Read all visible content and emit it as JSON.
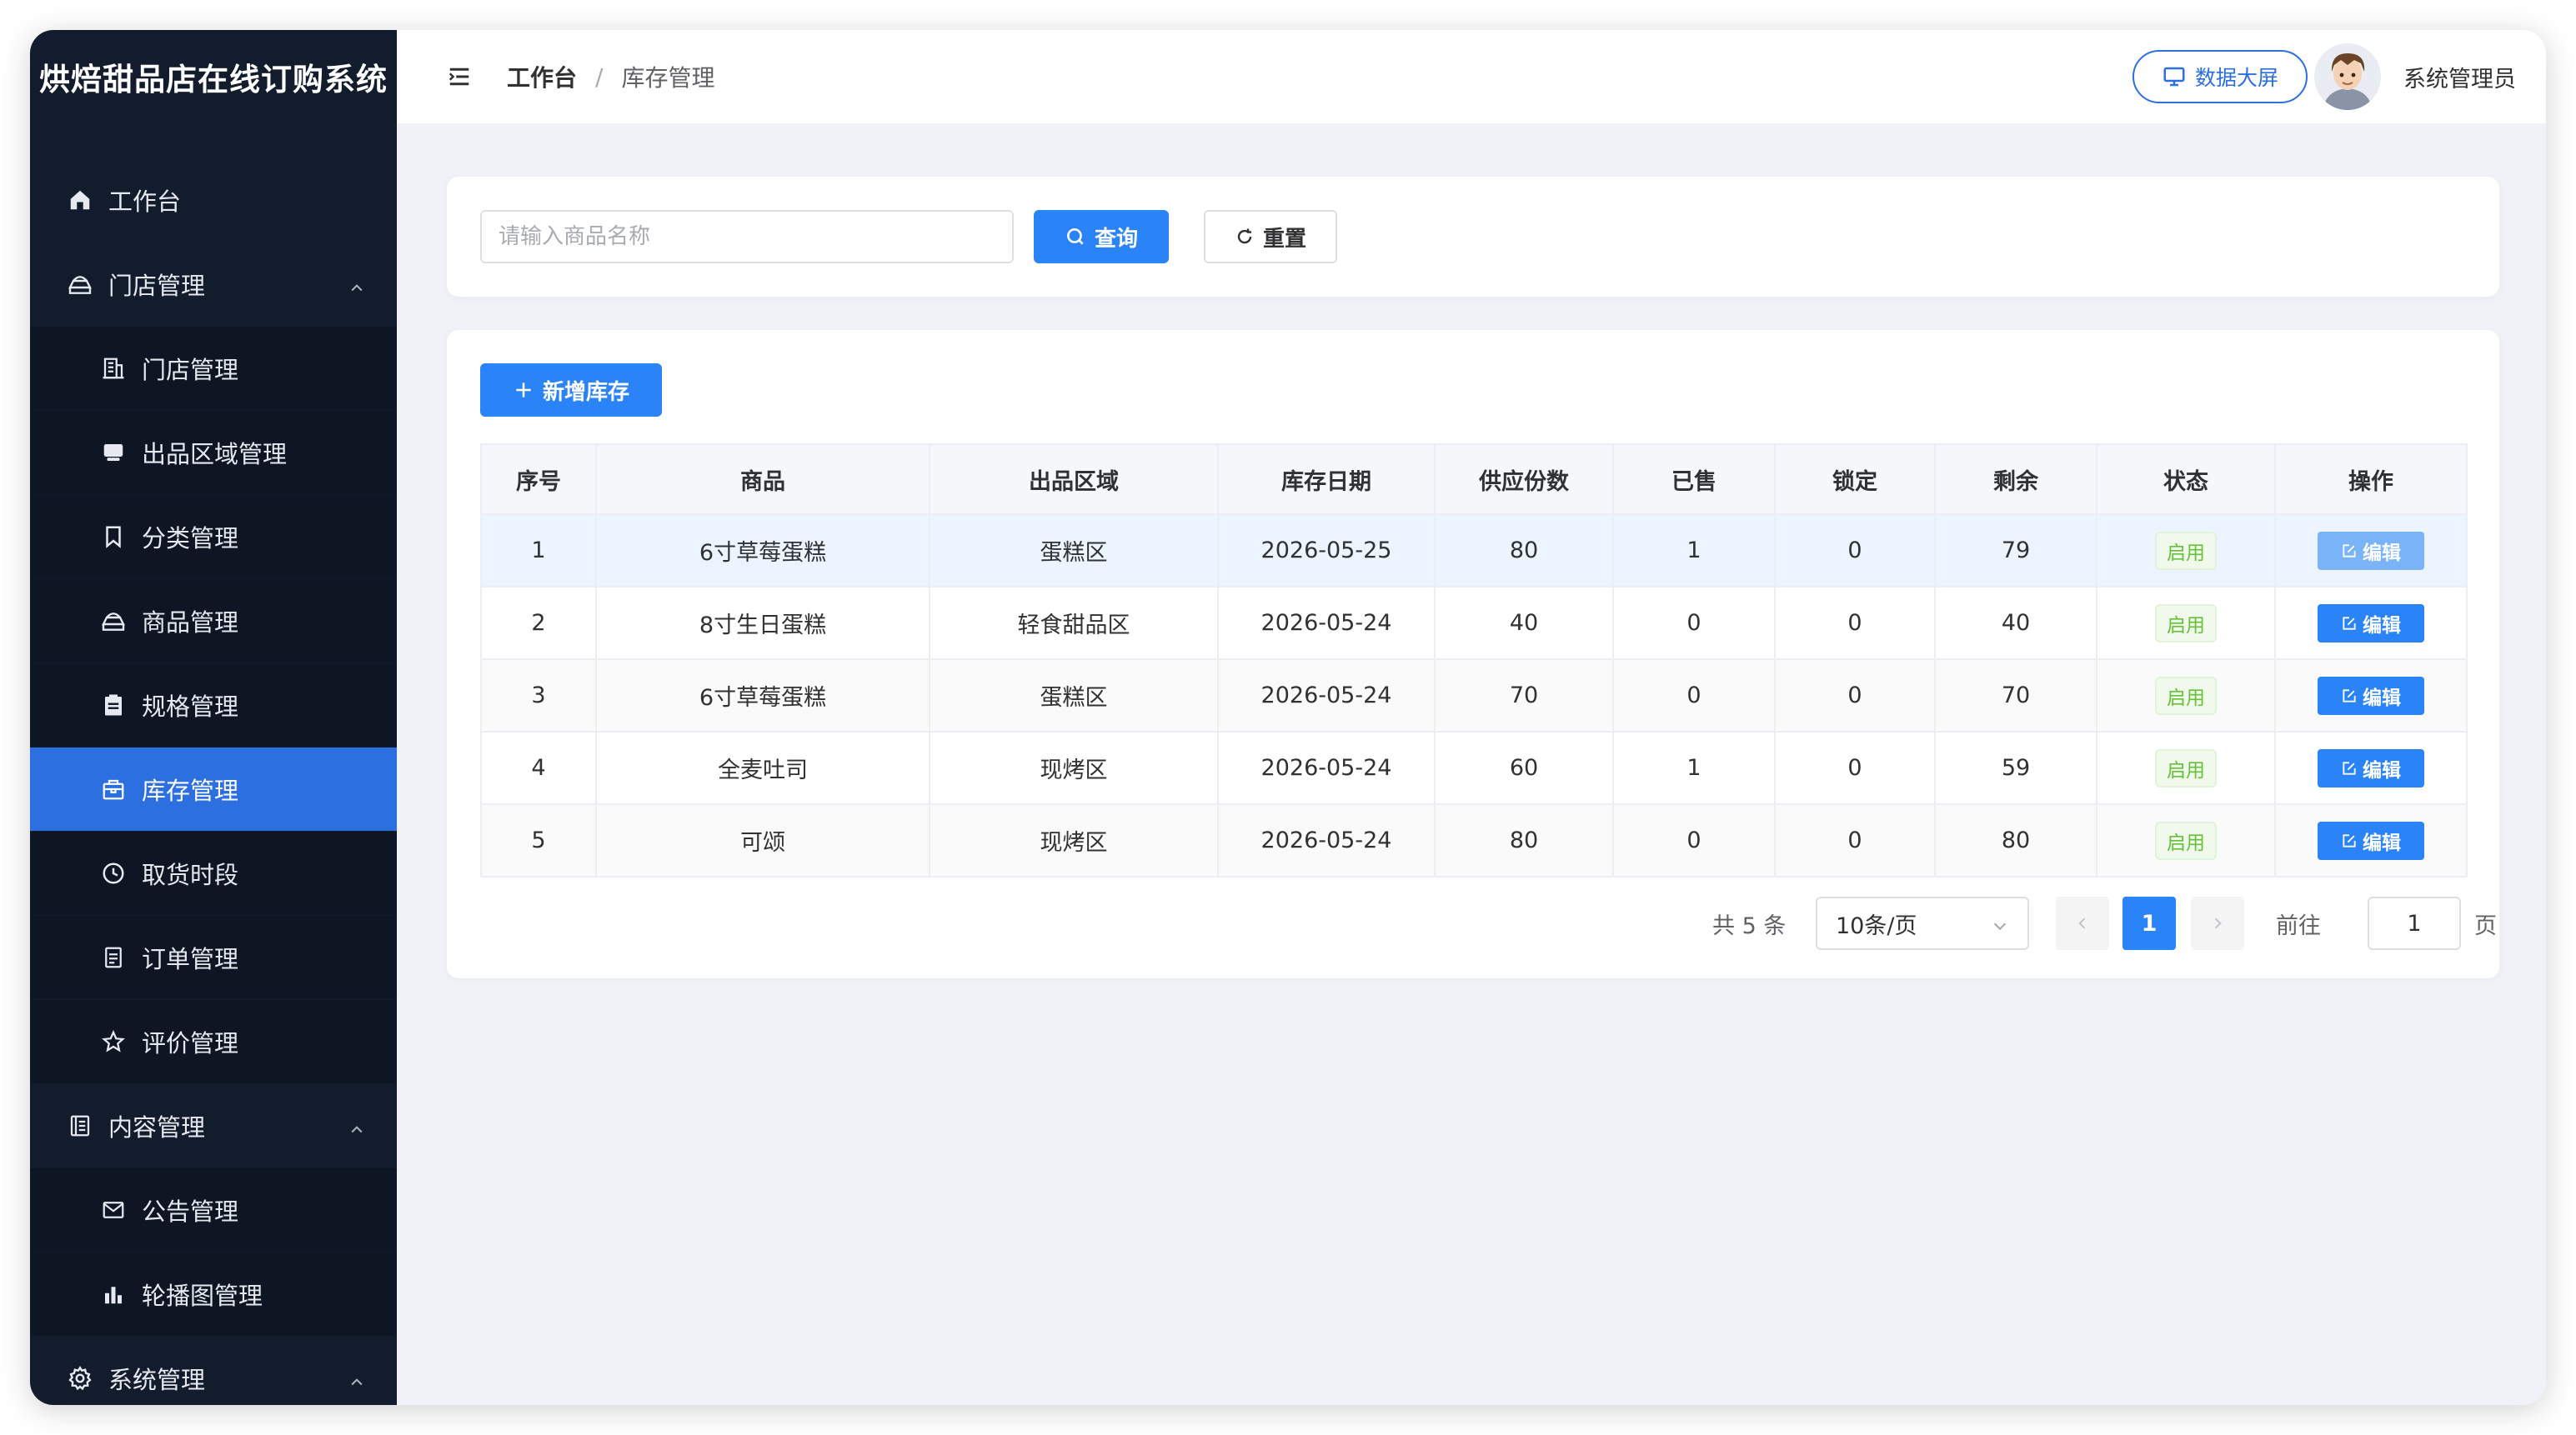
{
  "app": {
    "title": "烘焙甜品店在线订购系统"
  },
  "sidebar": {
    "items": [
      {
        "label": "工作台",
        "icon": "home-icon",
        "level": "top",
        "active": false
      },
      {
        "label": "门店管理",
        "icon": "store-icon",
        "level": "top",
        "expanded": true
      },
      {
        "label": "门店管理",
        "icon": "building-icon",
        "level": "sub",
        "active": false
      },
      {
        "label": "出品区域管理",
        "icon": "tray-icon",
        "level": "sub",
        "active": false
      },
      {
        "label": "分类管理",
        "icon": "bookmark-icon",
        "level": "sub",
        "active": false
      },
      {
        "label": "商品管理",
        "icon": "cake-icon",
        "level": "sub",
        "active": false
      },
      {
        "label": "规格管理",
        "icon": "clipboard-icon",
        "level": "sub",
        "active": false
      },
      {
        "label": "库存管理",
        "icon": "box-icon",
        "level": "sub",
        "active": true
      },
      {
        "label": "取货时段",
        "icon": "clock-icon",
        "level": "sub",
        "active": false
      },
      {
        "label": "订单管理",
        "icon": "document-icon",
        "level": "sub",
        "active": false
      },
      {
        "label": "评价管理",
        "icon": "star-icon",
        "level": "sub",
        "active": false
      },
      {
        "label": "内容管理",
        "icon": "notebook-icon",
        "level": "top",
        "expanded": true
      },
      {
        "label": "公告管理",
        "icon": "mail-icon",
        "level": "sub",
        "active": false
      },
      {
        "label": "轮播图管理",
        "icon": "bar-chart-icon",
        "level": "sub",
        "active": false
      },
      {
        "label": "系统管理",
        "icon": "gear-icon",
        "level": "top",
        "expanded": true
      }
    ]
  },
  "header": {
    "breadcrumb": [
      "工作台",
      "库存管理"
    ],
    "separator": "/",
    "screen_button": "数据大屏",
    "username": "系统管理员"
  },
  "search": {
    "placeholder": "请输入商品名称",
    "value": "",
    "query_label": "查询",
    "reset_label": "重置"
  },
  "toolbar": {
    "add_label": "新增库存"
  },
  "table": {
    "columns": [
      "序号",
      "商品",
      "出品区域",
      "库存日期",
      "供应份数",
      "已售",
      "锁定",
      "剩余",
      "状态",
      "操作"
    ],
    "rows": [
      [
        "1",
        "6寸草莓蛋糕",
        "蛋糕区",
        "2026-05-25",
        "80",
        "1",
        "0",
        "79",
        "启用",
        "编辑"
      ],
      [
        "2",
        "8寸生日蛋糕",
        "轻食甜品区",
        "2026-05-24",
        "40",
        "0",
        "0",
        "40",
        "启用",
        "编辑"
      ],
      [
        "3",
        "6寸草莓蛋糕",
        "蛋糕区",
        "2026-05-24",
        "70",
        "0",
        "0",
        "70",
        "启用",
        "编辑"
      ],
      [
        "4",
        "全麦吐司",
        "现烤区",
        "2026-05-24",
        "60",
        "1",
        "0",
        "59",
        "启用",
        "编辑"
      ],
      [
        "5",
        "可颂",
        "现烤区",
        "2026-05-24",
        "80",
        "0",
        "0",
        "80",
        "启用",
        "编辑"
      ]
    ]
  },
  "pagination": {
    "total_text": "共 5 条",
    "page_size": "10条/页",
    "current_page": "1",
    "goto_label": "前往",
    "goto_value": "1",
    "page_suffix": "页"
  },
  "colors": {
    "sidebar_bg": "#131c2c",
    "accent": "#2b84f7",
    "active_menu": "#2b6fe0",
    "status_green": "#67c23a"
  }
}
